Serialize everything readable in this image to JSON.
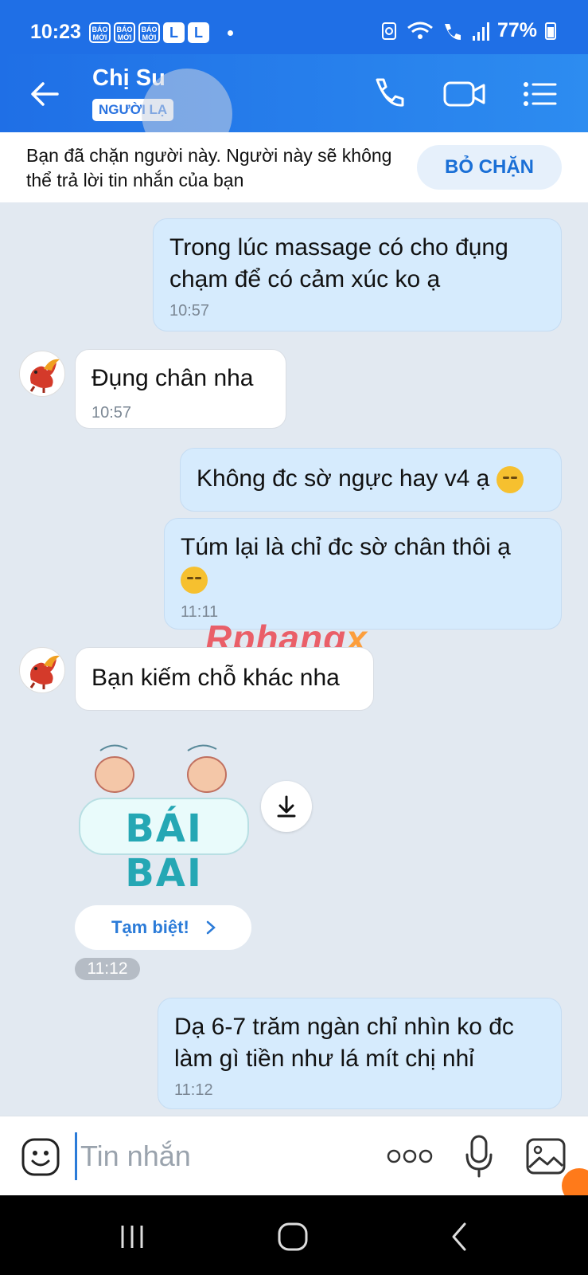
{
  "status_bar": {
    "time": "10:23",
    "badges": [
      "BÁO MỚI",
      "BÁO MỚI",
      "BÁO MỚI",
      "L",
      "L"
    ],
    "battery": "77%"
  },
  "header": {
    "contact_name": "Chị Su",
    "badge": "NGƯỜI LẠ",
    "icons": [
      "back-arrow-icon",
      "phone-icon",
      "video-camera-icon",
      "menu-list-icon"
    ]
  },
  "block_banner": {
    "text": "Bạn đã chặn người này. Người này sẽ không thể trả lời tin nhắn của bạn",
    "button": "BỎ CHẶN"
  },
  "messages": [
    {
      "side": "out",
      "text_lines": [
        "Trong lúc massage có cho đụng",
        "chạm để có cảm xúc ko ạ"
      ],
      "time": "10:57"
    },
    {
      "side": "in",
      "text_lines": [
        "Đụng chân nha"
      ],
      "time": "10:57"
    },
    {
      "side": "out",
      "text_lines": [
        "Không đc sờ ngực hay v4 ạ"
      ],
      "emoji": "thinking-face-emoji"
    },
    {
      "side": "out",
      "text_lines": [
        "Túm lại là chỉ đc sờ chân thôi ạ"
      ],
      "emoji": "pensive-face-emoji",
      "time": "11:11"
    },
    {
      "side": "in",
      "text_lines": [
        "Bạn kiếm chỗ khác nha"
      ]
    },
    {
      "side": "in",
      "type": "sticker",
      "sticker_text": "BÁI BAI",
      "action_icon": "download-icon"
    },
    {
      "side": "in",
      "type": "quick_reply",
      "text": "Tạm biệt!",
      "time": "11:12"
    },
    {
      "side": "out",
      "text_lines": [
        "Dạ 6-7 trăm ngàn chỉ nhìn ko đc",
        "làm gì tiền như lá mít chị nhỉ"
      ],
      "time": "11:12"
    }
  ],
  "watermark": {
    "main": "Rphang",
    "tail": "x"
  },
  "input": {
    "placeholder": "Tin nhắn",
    "value": ""
  },
  "colors": {
    "header_blue": "#1f6fe6",
    "bubble_out": "#d6ebfd",
    "chat_bg": "#e2e9f1",
    "accent": "#2b7bd8"
  }
}
